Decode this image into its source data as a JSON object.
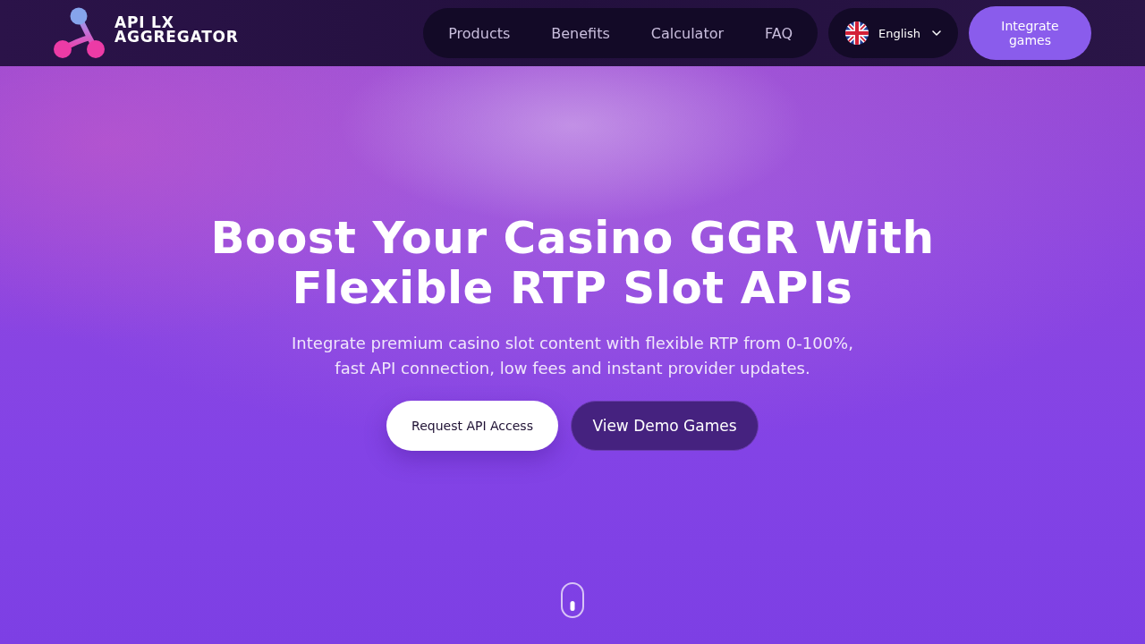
{
  "header": {
    "logo": {
      "line_1": "API LX",
      "line_2": "AGGREGATOR"
    },
    "nav": [
      {
        "label": "Products"
      },
      {
        "label": "Benefits"
      },
      {
        "label": "Calculator"
      },
      {
        "label": "FAQ"
      }
    ],
    "language": {
      "label": "English"
    },
    "cta": "Integrate games"
  },
  "hero": {
    "title_lines": [
      "Boost Your Casino GGR With",
      "Flexible RTP Slot APIs"
    ],
    "subtitle_lines": [
      "Integrate premium casino slot content with flexible RTP from 0-100%,",
      "fast API connection, low fees and instant provider updates."
    ],
    "buttons": [
      {
        "label": "Request API Access",
        "kind": "primary"
      },
      {
        "label": "View Demo Games",
        "kind": "secondary"
      }
    ]
  }
}
